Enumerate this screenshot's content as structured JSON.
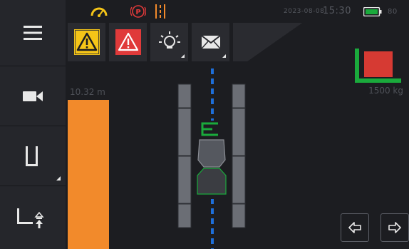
{
  "status": {
    "date": "2023-08-08",
    "time": "15:30",
    "battery_level_text": "80"
  },
  "alerts": [
    {
      "icon": "caution-icon",
      "color": "#f5c518"
    },
    {
      "icon": "hazard-icon",
      "color": "#e03a3a"
    },
    {
      "icon": "light-icon",
      "color": "#e8e8e8"
    },
    {
      "icon": "mail-icon",
      "color": "#e8e8e8"
    }
  ],
  "sidebar": {
    "items": [
      {
        "icon": "menu-icon"
      },
      {
        "icon": "camera-icon"
      },
      {
        "icon": "fork-icon"
      },
      {
        "icon": "fork-height-icon"
      }
    ]
  },
  "distance": {
    "value_label": "10.32 m",
    "color": "#f28a2b"
  },
  "load": {
    "weight_label": "1500 kg",
    "color": "#d63a33",
    "fork_color": "#1aaa3c"
  },
  "path": {
    "lane_color": "#1e6fd9",
    "rail_color": "#6b6e75",
    "vehicle_outline_color": "#1aaa3c"
  },
  "nav": {
    "prev_icon": "arrow-left-icon",
    "next_icon": "arrow-right-icon"
  }
}
